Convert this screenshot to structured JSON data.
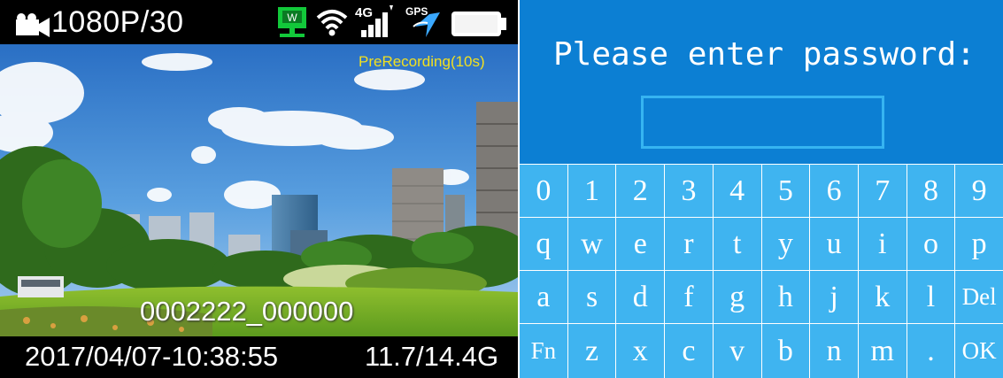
{
  "camera": {
    "resolution": "1080P/30",
    "prerecording": "PreRecording(10s)",
    "file_name": "0002222_000000",
    "datetime": "2017/04/07-10:38:55",
    "storage": "11.7/14.4G",
    "status_icons": [
      "video-camera-icon",
      "wlan-icon",
      "wifi-icon",
      "4g-signal-icon",
      "gps-icon",
      "battery-icon"
    ],
    "wlan_label": "W",
    "lte_label": "4G",
    "gps_label": "GPS",
    "colors": {
      "prerecording": "#f2e01f",
      "wlan": "#12c83a",
      "status": "#ffffff"
    }
  },
  "password": {
    "prompt": "Please enter password:",
    "input_value": "",
    "keyboard": {
      "rows": [
        [
          "0",
          "1",
          "2",
          "3",
          "4",
          "5",
          "6",
          "7",
          "8",
          "9"
        ],
        [
          "q",
          "w",
          "e",
          "r",
          "t",
          "y",
          "u",
          "i",
          "o",
          "p"
        ],
        [
          "a",
          "s",
          "d",
          "f",
          "g",
          "h",
          "j",
          "k",
          "l",
          "Del"
        ],
        [
          "Fn",
          "z",
          "x",
          "c",
          "v",
          "b",
          "n",
          "m",
          ".",
          "OK"
        ]
      ]
    },
    "colors": {
      "background": "#0c7fd3",
      "keyboard": "#3fb4f0",
      "input_border": "#36b4f1"
    }
  }
}
